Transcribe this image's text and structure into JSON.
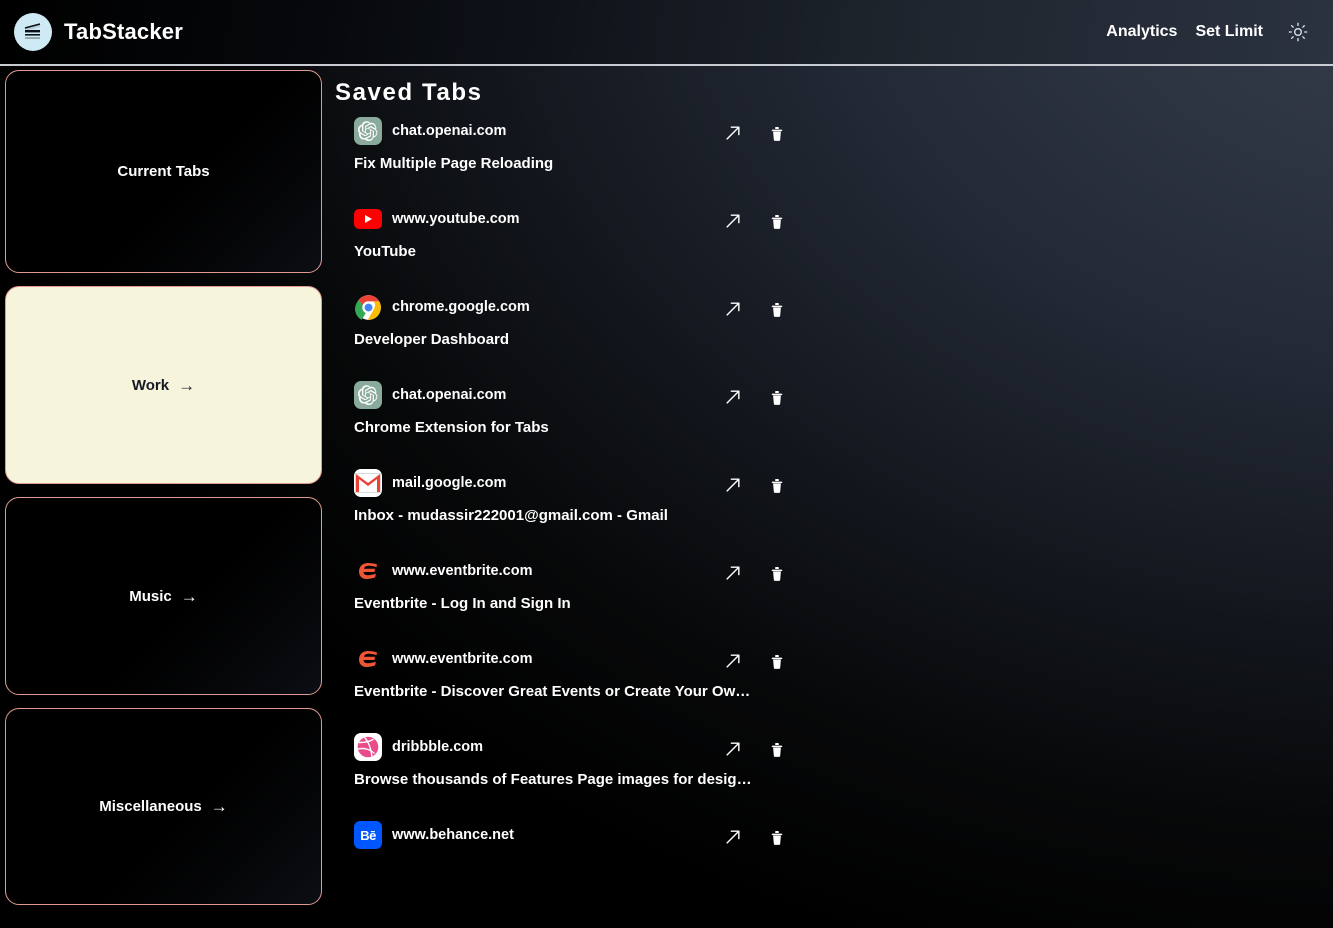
{
  "header": {
    "brand_title": "TabStacker",
    "logo_icon": "stacked-layers-icon",
    "nav": [
      {
        "label": "Analytics",
        "name": "analytics"
      },
      {
        "label": "Set Limit",
        "name": "set-limit"
      }
    ],
    "theme_toggle_icon": "sun-icon"
  },
  "sidebar": {
    "cards": [
      {
        "label": "Current Tabs",
        "theme": "dark",
        "has_arrow": false,
        "name": "current-tabs"
      },
      {
        "label": "Work",
        "theme": "light",
        "has_arrow": true,
        "name": "work"
      },
      {
        "label": "Music",
        "theme": "dark",
        "has_arrow": true,
        "name": "music"
      },
      {
        "label": "Miscellaneous",
        "theme": "dark",
        "has_arrow": true,
        "name": "miscellaneous"
      }
    ],
    "arrow_glyph": "→"
  },
  "main": {
    "title": "Saved  Tabs",
    "actions": {
      "open_icon": "arrow-up-right-icon",
      "delete_icon": "trash-icon"
    },
    "tabs": [
      {
        "domain": "chat.openai.com",
        "title": "Fix Multiple Page Reloading",
        "favicon": "openai"
      },
      {
        "domain": "www.youtube.com",
        "title": "YouTube",
        "favicon": "youtube"
      },
      {
        "domain": "chrome.google.com",
        "title": "Developer Dashboard",
        "favicon": "chrome"
      },
      {
        "domain": "chat.openai.com",
        "title": "Chrome Extension for Tabs",
        "favicon": "openai"
      },
      {
        "domain": "mail.google.com",
        "title": "Inbox - mudassir222001@gmail.com - Gmail",
        "favicon": "gmail"
      },
      {
        "domain": "www.eventbrite.com",
        "title": "Eventbrite - Log In and Sign In",
        "favicon": "eventbrite"
      },
      {
        "domain": "www.eventbrite.com",
        "title": "Eventbrite - Discover Great Events or Create Your Ow…",
        "favicon": "eventbrite"
      },
      {
        "domain": "dribbble.com",
        "title": "Browse thousands of Features Page images for desig…",
        "favicon": "dribbble"
      },
      {
        "domain": "www.behance.net",
        "title": "",
        "favicon": "behance"
      }
    ]
  },
  "colors": {
    "card_border": "#e09a91",
    "card_light_bg": "#f7f4dc",
    "brand_logo_bg": "#cfeaf5",
    "header_divider": "#c8ccd2",
    "text_primary": "#ffffff"
  }
}
